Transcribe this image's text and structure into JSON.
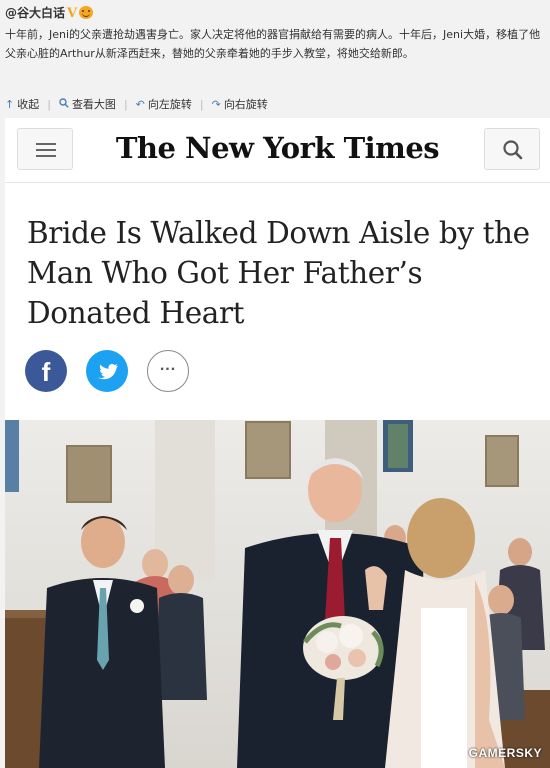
{
  "post": {
    "author": "@谷大白话",
    "verified_badge": "V",
    "text": "十年前，Jeni的父亲遭抢劫遇害身亡。家人决定将他的器官捐献给有需要的病人。十年后，Jeni大婚，移植了他父亲心脏的Arthur从新泽西赶来，替她的父亲牵着她的手步入教堂，将她交给新郎。",
    "actions": [
      {
        "label": "收起",
        "icon": "collapse-icon"
      },
      {
        "label": "查看大图",
        "icon": "magnify-icon"
      },
      {
        "label": "向左旋转",
        "icon": "rotate-left-icon"
      },
      {
        "label": "向右旋转",
        "icon": "rotate-right-icon"
      }
    ]
  },
  "article": {
    "logo": "The New York Times",
    "headline": "Bride Is Walked Down Aisle by the Man Who Got Her Father’s Donated Heart",
    "share": {
      "facebook": "f",
      "more": "..."
    },
    "watermark": "GAMERSKY"
  },
  "colors": {
    "facebook": "#3b5998",
    "twitter": "#1da1f2",
    "link_icon": "#4a7fb5",
    "tie": "#9b1b30"
  }
}
